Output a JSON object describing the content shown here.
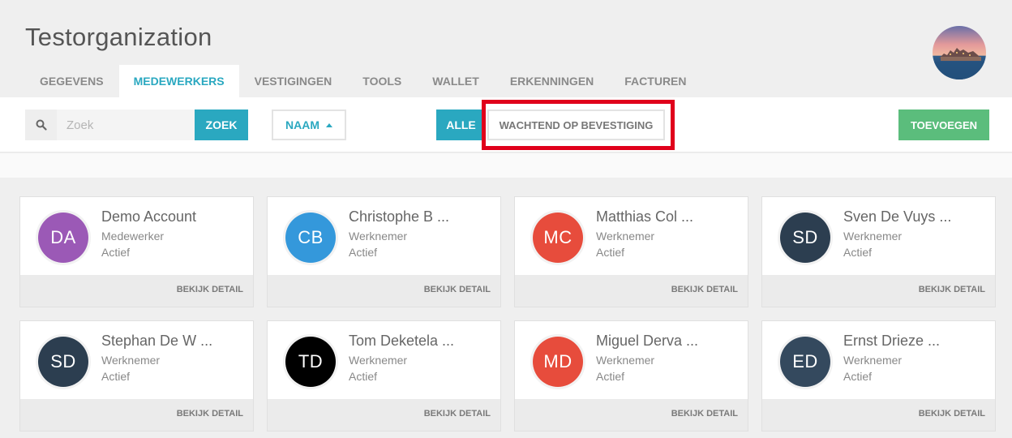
{
  "header": {
    "org_name": "Testorganization"
  },
  "tabs": [
    {
      "label": "GEGEVENS",
      "active": false
    },
    {
      "label": "MEDEWERKERS",
      "active": true
    },
    {
      "label": "VESTIGINGEN",
      "active": false
    },
    {
      "label": "TOOLS",
      "active": false
    },
    {
      "label": "WALLET",
      "active": false
    },
    {
      "label": "ERKENNINGEN",
      "active": false
    },
    {
      "label": "FACTUREN",
      "active": false
    }
  ],
  "toolbar": {
    "search_placeholder": "Zoek",
    "search_value": "",
    "search_button": "ZOEK",
    "sort_label": "NAAM",
    "filter_all": "ALLE",
    "filter_pending": "WACHTEND OP BEVESTIGING",
    "add_button": "TOEVOEGEN"
  },
  "colors": {
    "accent": "#2aa8c0",
    "add_button": "#5bbd7c",
    "highlight": "#e0001b"
  },
  "employees": [
    {
      "initials": "DA",
      "name": "Demo Account",
      "role": "Medewerker",
      "status": "Actief",
      "color": "#9b59b6",
      "detail": "BEKIJK DETAIL"
    },
    {
      "initials": "CB",
      "name": "Christophe B ...",
      "role": "Werknemer",
      "status": "Actief",
      "color": "#3498db",
      "detail": "BEKIJK DETAIL"
    },
    {
      "initials": "MC",
      "name": "Matthias Col ...",
      "role": "Werknemer",
      "status": "Actief",
      "color": "#e74c3c",
      "detail": "BEKIJK DETAIL"
    },
    {
      "initials": "SD",
      "name": "Sven De Vuys ...",
      "role": "Werknemer",
      "status": "Actief",
      "color": "#2c3e50",
      "detail": "BEKIJK DETAIL"
    },
    {
      "initials": "SD",
      "name": "Stephan De W ...",
      "role": "Werknemer",
      "status": "Actief",
      "color": "#2c3e50",
      "detail": "BEKIJK DETAIL"
    },
    {
      "initials": "TD",
      "name": "Tom Deketela ...",
      "role": "Werknemer",
      "status": "Actief",
      "color": "#000000",
      "detail": "BEKIJK DETAIL"
    },
    {
      "initials": "MD",
      "name": "Miguel Derva ...",
      "role": "Werknemer",
      "status": "Actief",
      "color": "#e74c3c",
      "detail": "BEKIJK DETAIL"
    },
    {
      "initials": "ED",
      "name": "Ernst Drieze ...",
      "role": "Werknemer",
      "status": "Actief",
      "color": "#34495e",
      "detail": "BEKIJK DETAIL"
    }
  ]
}
